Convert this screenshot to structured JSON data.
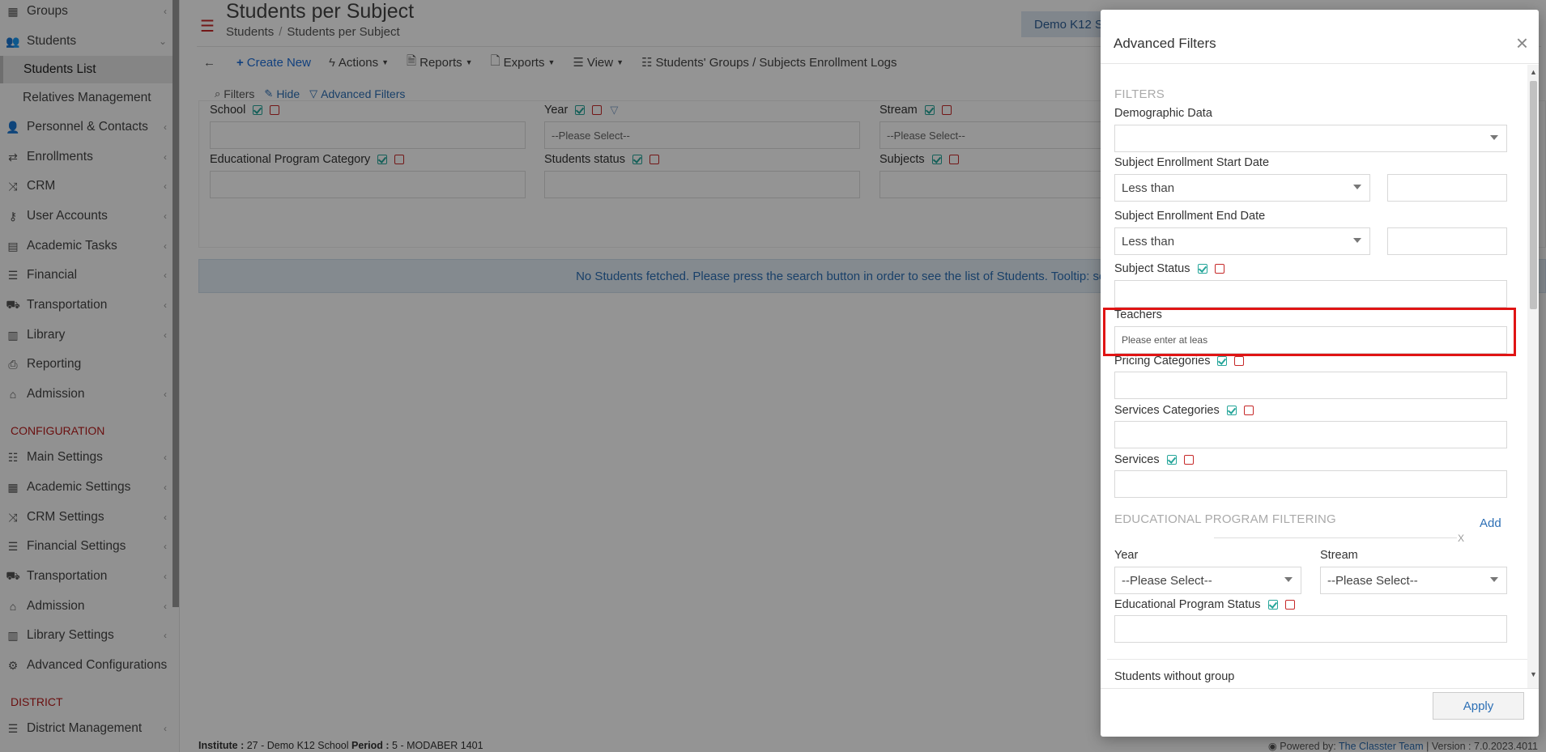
{
  "sidebar": {
    "items": [
      {
        "label": "Groups",
        "icon": "groups-icon"
      },
      {
        "label": "Students",
        "icon": "students-icon"
      },
      {
        "label": "Students List"
      },
      {
        "label": "Relatives Management"
      },
      {
        "label": "Personnel & Contacts",
        "icon": "personnel-icon"
      },
      {
        "label": "Enrollments",
        "icon": "enrollments-icon"
      },
      {
        "label": "CRM",
        "icon": "crm-icon"
      },
      {
        "label": "User Accounts",
        "icon": "key-icon"
      },
      {
        "label": "Academic Tasks",
        "icon": "tasks-icon"
      },
      {
        "label": "Financial",
        "icon": "financial-icon"
      },
      {
        "label": "Transportation",
        "icon": "bus-icon"
      },
      {
        "label": "Library",
        "icon": "library-icon"
      },
      {
        "label": "Reporting",
        "icon": "printer-icon"
      },
      {
        "label": "Admission",
        "icon": "institution-icon"
      }
    ],
    "config_heading": "CONFIGURATION",
    "config_items": [
      {
        "label": "Main Settings",
        "icon": "sliders-icon"
      },
      {
        "label": "Academic Settings",
        "icon": "groups-icon"
      },
      {
        "label": "CRM Settings",
        "icon": "crm-icon"
      },
      {
        "label": "Financial Settings",
        "icon": "financial-icon"
      },
      {
        "label": "Transportation",
        "icon": "bus-icon"
      },
      {
        "label": "Admission",
        "icon": "institution-icon"
      },
      {
        "label": "Library Settings",
        "icon": "library-icon"
      },
      {
        "label": "Advanced Configurations",
        "icon": "gears-icon"
      }
    ],
    "district_heading": "DISTRICT",
    "district_items": [
      {
        "label": "District Management",
        "icon": "menu-icon"
      }
    ]
  },
  "header": {
    "title": "Students per Subject",
    "breadcrumb": [
      "Students",
      "Students per Subject"
    ],
    "school_badge": "Demo K12 S"
  },
  "toolbar": {
    "create_new": "Create New",
    "actions": "Actions",
    "reports": "Reports",
    "exports": "Exports",
    "view": "View",
    "logs": "Students' Groups / Subjects Enrollment Logs"
  },
  "filters_bar": {
    "filters": "Filters",
    "hide": "Hide",
    "advanced": "Advanced Filters"
  },
  "filters": {
    "school": "School",
    "year": "Year",
    "year_placeholder": "--Please Select--",
    "stream": "Stream",
    "stream_placeholder": "--Please Select--",
    "edu_program_category": "Educational Program Category",
    "students_status": "Students status",
    "subjects": "Subjects"
  },
  "notice": "No Students fetched. Please press the search button in order to see the list of Students. Tooltip: set some filter",
  "footer": {
    "institute_label": "Institute :",
    "institute_value": "27 - Demo K12 School",
    "period_label": "Period :",
    "period_value": "5 - MODABER 1401",
    "powered_by": "Powered by:",
    "team": "The Classter Team",
    "version": "| Version : 7.0.2023.4011"
  },
  "modal": {
    "title": "Advanced Filters",
    "close": "×",
    "section_filters": "FILTERS",
    "demographic_data": "Demographic Data",
    "start_date_label": "Subject Enrollment Start Date",
    "start_date_op": "Less than",
    "end_date_label": "Subject Enrollment End Date",
    "end_date_op": "Less than",
    "subject_status": "Subject Status",
    "teachers": "Teachers",
    "teachers_placeholder": "Please enter at leas",
    "pricing_categories": "Pricing Categories",
    "services_categories": "Services Categories",
    "services": "Services",
    "section_ep": "EDUCATIONAL PROGRAM FILTERING",
    "add": "Add",
    "x": "X",
    "year": "Year",
    "year_value": "--Please Select--",
    "stream": "Stream",
    "stream_value": "--Please Select--",
    "ep_status": "Educational Program Status",
    "students_without_group": "Students without group",
    "apply": "Apply"
  }
}
